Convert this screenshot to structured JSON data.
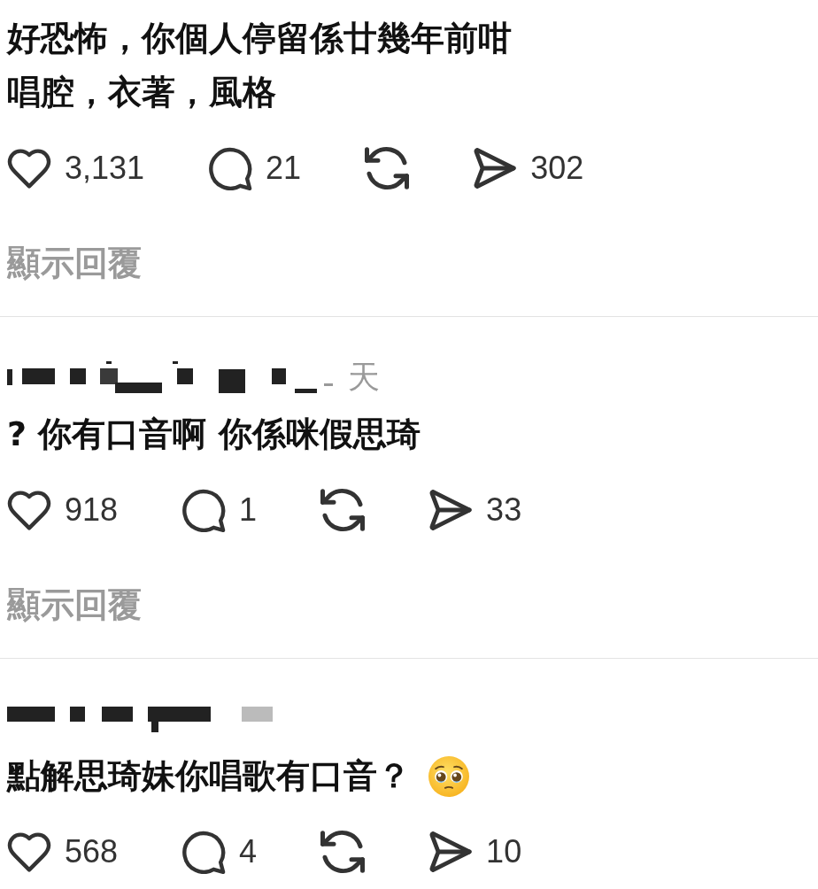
{
  "comments": [
    {
      "lines": [
        "好恐怖，你個人停留係廿幾年前咁",
        "唱腔，衣著，風格"
      ],
      "actions": [
        {
          "kind": "like",
          "count": "3,131"
        },
        {
          "kind": "reply",
          "count": "21"
        },
        {
          "kind": "repost"
        },
        {
          "kind": "share",
          "count": "302"
        }
      ],
      "show_replies": "顯示回覆"
    },
    {
      "author": {
        "redacted": true,
        "time": "天"
      },
      "lines": [
        "? 你有口音啊 你係咪假思琦"
      ],
      "actions": [
        {
          "kind": "like",
          "count": "918"
        },
        {
          "kind": "reply",
          "count": "1"
        },
        {
          "kind": "repost"
        },
        {
          "kind": "share",
          "count": "33"
        }
      ],
      "show_replies": "顯示回覆"
    },
    {
      "author": {
        "redacted": true
      },
      "lines": [
        "點解思琦妹你唱歌有口音？"
      ],
      "emoji": true,
      "actions": [
        {
          "kind": "like",
          "count": "568"
        },
        {
          "kind": "reply",
          "count": "4"
        },
        {
          "kind": "repost"
        },
        {
          "kind": "share",
          "count": "10"
        }
      ]
    }
  ]
}
